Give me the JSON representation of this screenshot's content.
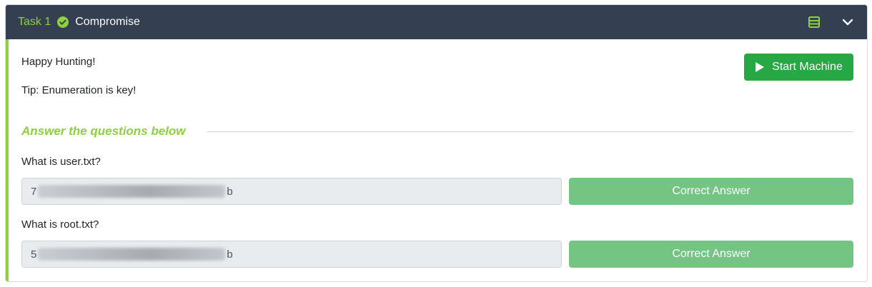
{
  "task": {
    "number_label": "Task 1",
    "title": "Compromise"
  },
  "body": {
    "paragraphs": [
      "Happy Hunting!",
      "Tip: Enumeration is key!"
    ],
    "start_button": "Start Machine",
    "answers_heading": "Answer the questions below"
  },
  "questions": [
    {
      "label": "What is user.txt?",
      "answer_start": "7",
      "answer_end": "b",
      "button": "Correct Answer"
    },
    {
      "label": "What is root.txt?",
      "answer_start": "5",
      "answer_end": "b",
      "button": "Correct Answer"
    }
  ],
  "colors": {
    "header_bg": "#343f51",
    "accent_green": "#8ed13f",
    "start_button": "#28a745",
    "correct_button": "#74c584"
  },
  "icons": {
    "completed": "check-circle-icon",
    "notes": "notes-icon",
    "collapse": "chevron-down-icon",
    "start": "play-icon"
  }
}
